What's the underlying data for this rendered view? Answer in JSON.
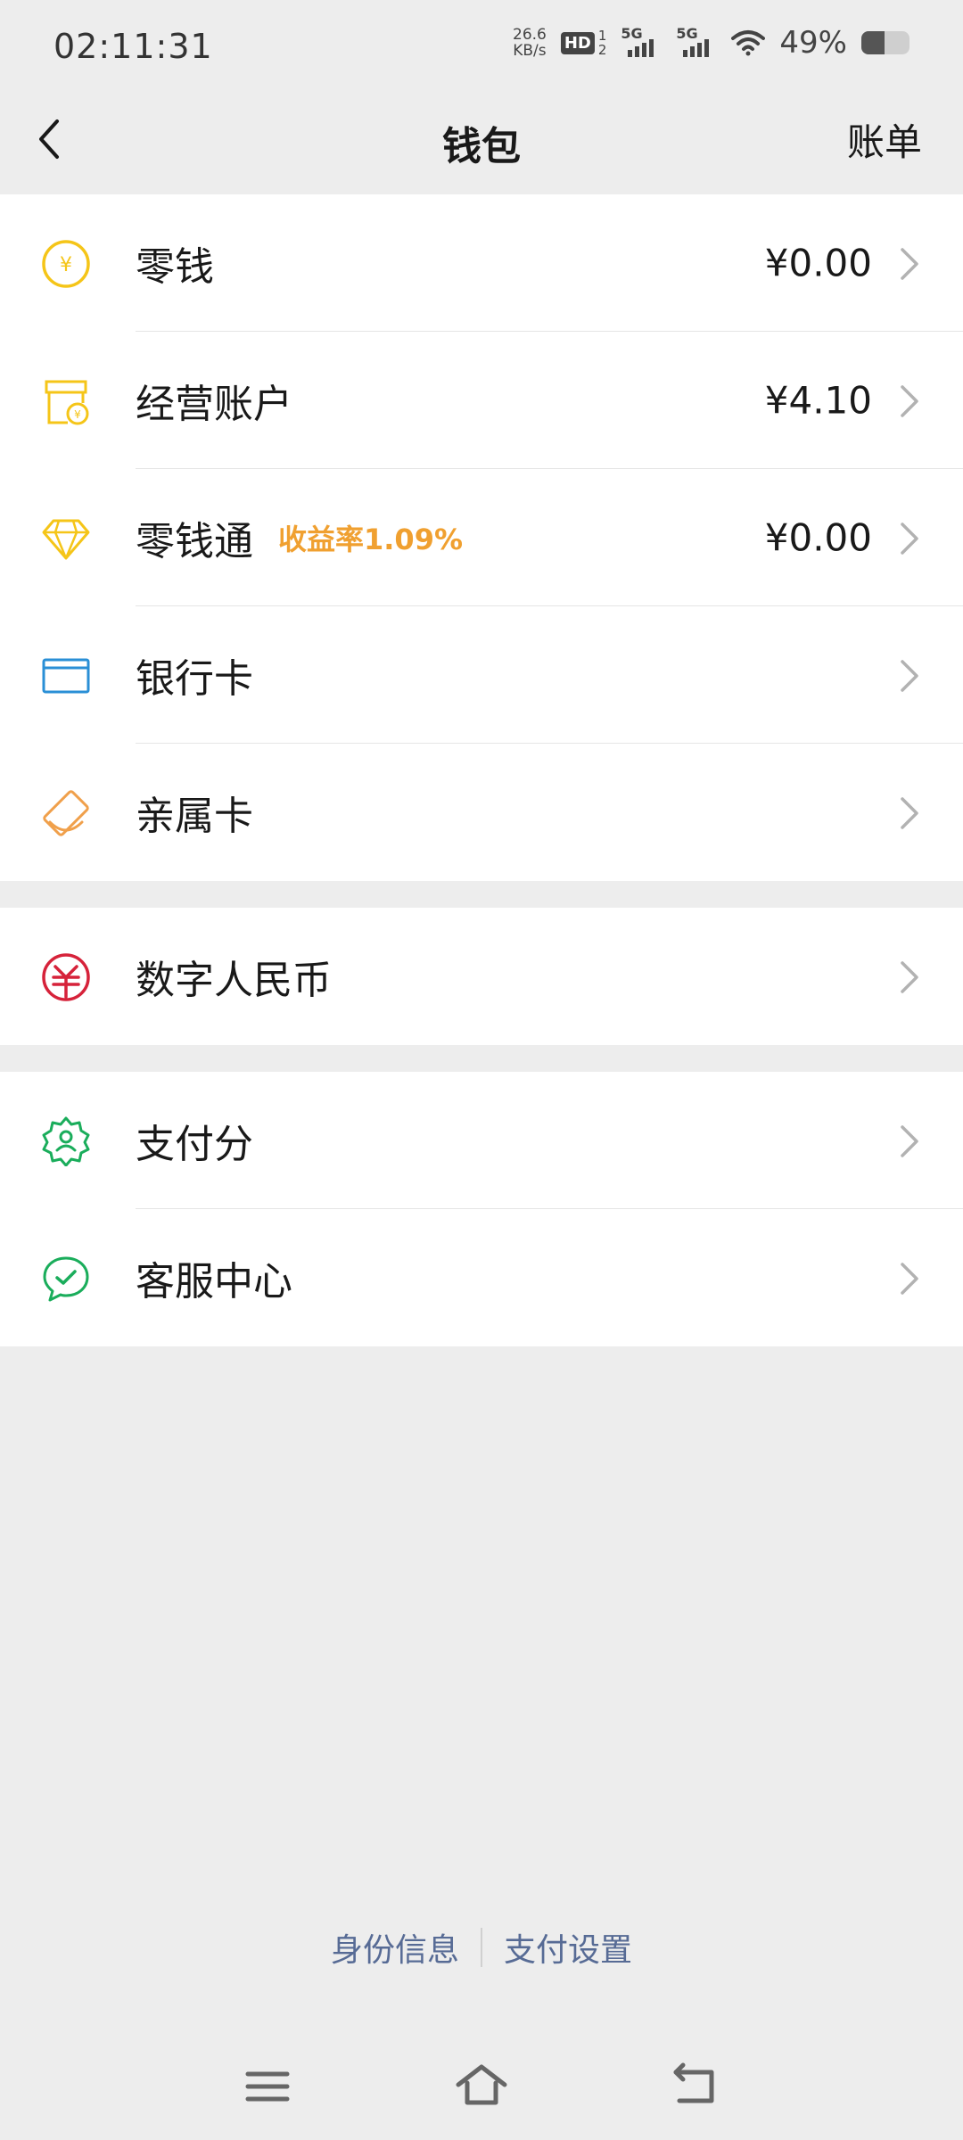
{
  "status_bar": {
    "time": "02:11:31",
    "net_speed_value": "26.6",
    "net_speed_unit": "KB/s",
    "hd_label": "HD",
    "hd_sub_top": "1",
    "hd_sub_bottom": "2",
    "sim1_label": "5G",
    "sim2_label": "5G",
    "battery_percent": "49%",
    "battery_level": 0.49,
    "icons": [
      "hd-voice-icon",
      "signal-icon",
      "signal-icon",
      "wifi-icon",
      "battery-icon"
    ]
  },
  "nav": {
    "title": "钱包",
    "action": "账单",
    "back_icon": "back-arrow-icon"
  },
  "groups": [
    {
      "items": [
        {
          "label": "零钱",
          "value": "¥0.00",
          "icon": "yuan-coin-icon",
          "color": "#f5c518"
        },
        {
          "label": "经营账户",
          "value": "¥4.10",
          "icon": "shop-account-icon",
          "color": "#f5c518"
        },
        {
          "label": "零钱通",
          "badge": "收益率1.09%",
          "value": "¥0.00",
          "icon": "diamond-icon",
          "color": "#f5c518"
        },
        {
          "label": "银行卡",
          "icon": "bank-card-icon",
          "color": "#2a8fd6"
        },
        {
          "label": "亲属卡",
          "icon": "family-card-icon",
          "color": "#f0a04b"
        }
      ]
    },
    {
      "items": [
        {
          "label": "数字人民币",
          "icon": "digital-rmb-icon",
          "color": "#d6223a"
        }
      ]
    },
    {
      "items": [
        {
          "label": "支付分",
          "icon": "pay-score-icon",
          "color": "#1aad5b"
        },
        {
          "label": "客服中心",
          "icon": "customer-service-icon",
          "color": "#1aad5b"
        }
      ]
    }
  ],
  "footer": {
    "link1": "身份信息",
    "link2": "支付设置",
    "link_color": "#576b95"
  },
  "system_nav": {
    "icons": [
      "menu-icon",
      "home-icon",
      "back-icon"
    ]
  }
}
